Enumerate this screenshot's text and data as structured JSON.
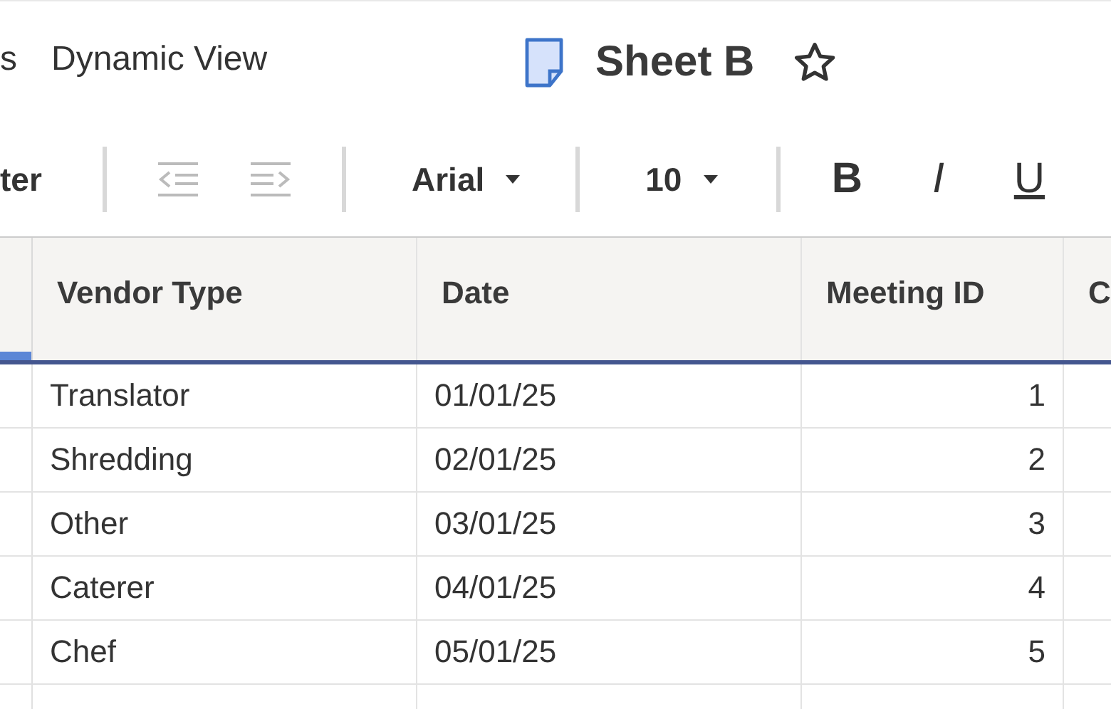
{
  "top_bar": {
    "nav_items": [
      "s",
      "Dynamic View"
    ],
    "sheet_title": "Sheet B"
  },
  "toolbar": {
    "cut_button": "ter",
    "font": "Arial",
    "font_size": "10",
    "format_buttons": [
      {
        "kind": "bold",
        "label": "B"
      },
      {
        "kind": "italic",
        "label": "I"
      },
      {
        "kind": "underline",
        "label": "U"
      }
    ]
  },
  "table": {
    "columns": [
      "Vendor Type",
      "Date",
      "Meeting ID",
      "C"
    ],
    "rows": [
      {
        "cells": [
          "Translator",
          "01/01/25",
          "1"
        ]
      },
      {
        "cells": [
          "Shredding",
          "02/01/25",
          "2"
        ]
      },
      {
        "cells": [
          "Other",
          "03/01/25",
          "3"
        ]
      },
      {
        "cells": [
          "Caterer",
          "04/01/25",
          "4"
        ]
      },
      {
        "cells": [
          "Chef",
          "05/01/25",
          "5"
        ]
      }
    ]
  }
}
